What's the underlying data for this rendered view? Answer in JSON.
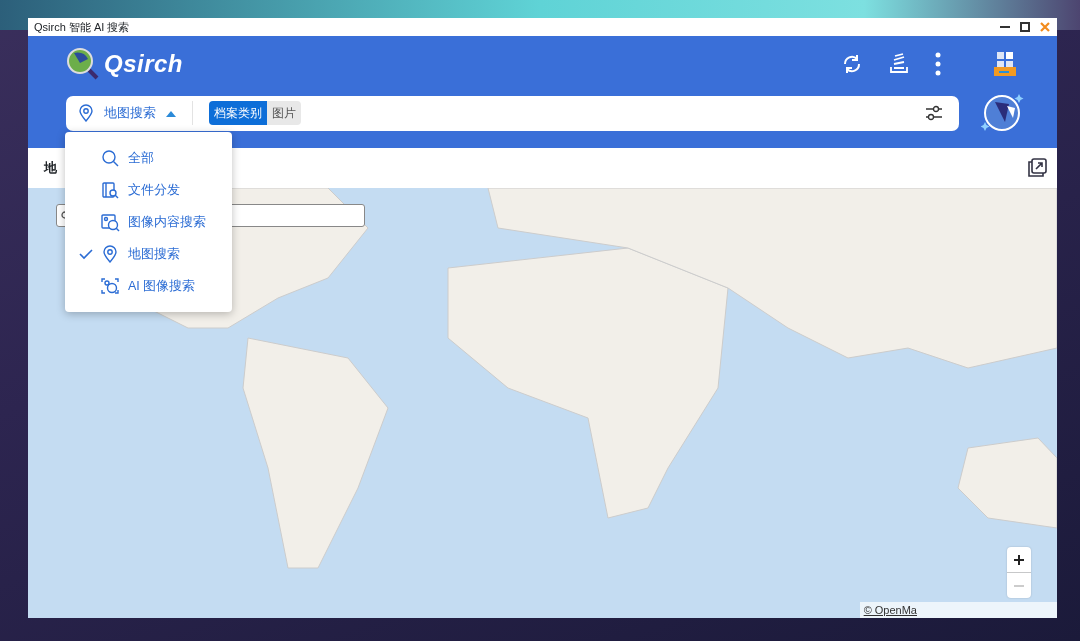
{
  "window": {
    "title": "Qsirch 智能 AI 搜索"
  },
  "app": {
    "logo": "Qsirch"
  },
  "search": {
    "mode": "地图搜索",
    "menu_expanded": true,
    "chip_label": "档案类别",
    "chip_value": "图片"
  },
  "mode_menu": [
    {
      "label": "全部",
      "selected": false
    },
    {
      "label": "文件分发",
      "selected": false
    },
    {
      "label": "图像内容搜索",
      "selected": false
    },
    {
      "label": "地图搜索",
      "selected": true
    },
    {
      "label": "AI 图像搜索",
      "selected": false
    }
  ],
  "panel": {
    "title": "地"
  },
  "map": {
    "attribution": "© OpenMa"
  }
}
